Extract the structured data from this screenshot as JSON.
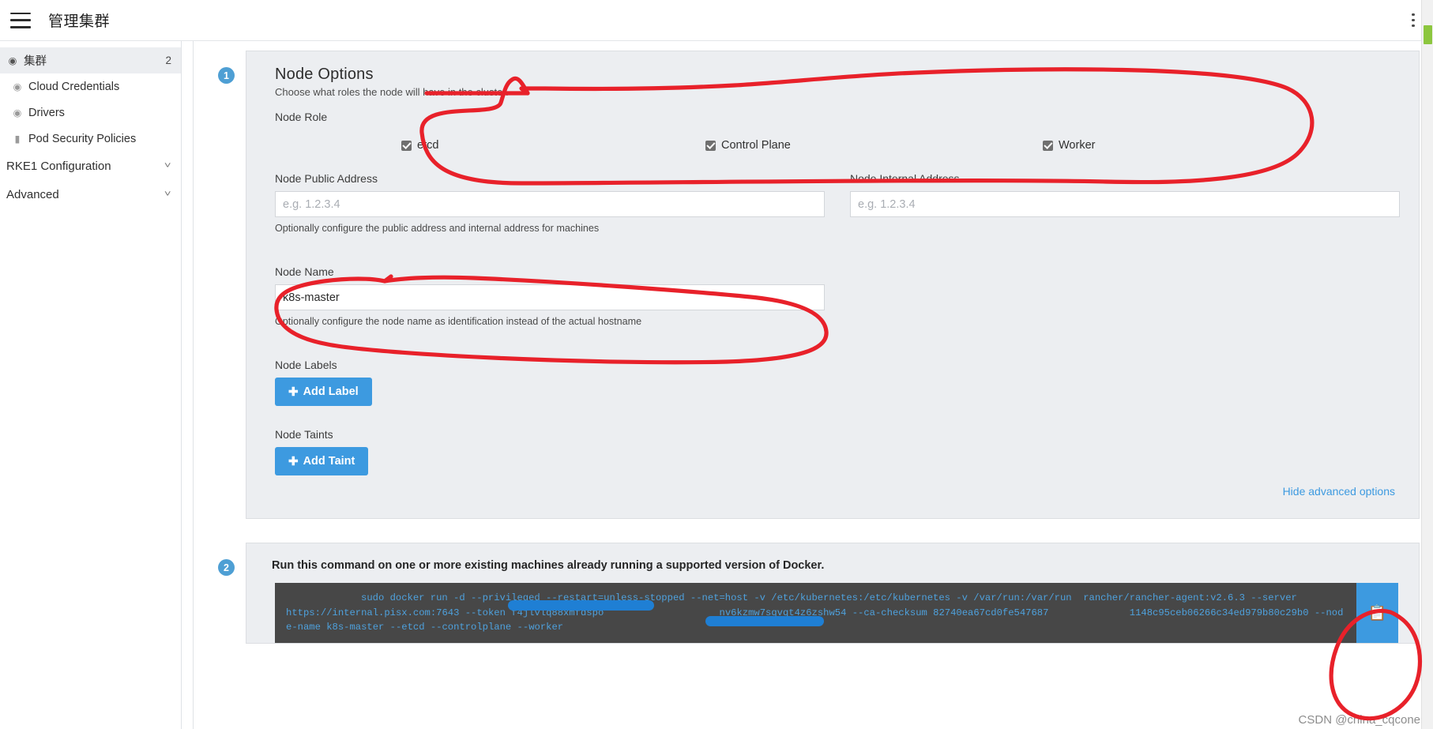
{
  "header": {
    "title": "管理集群",
    "menu_icon": "hamburger-icon",
    "overflow_icon": "kebab-menu-icon"
  },
  "sidebar": {
    "items": [
      {
        "label": "集群",
        "icon": "globe-icon",
        "badge": "2",
        "active": true
      },
      {
        "label": "Cloud Credentials",
        "icon": "globe-icon",
        "badge": "",
        "active": false
      },
      {
        "label": "Drivers",
        "icon": "globe-icon",
        "badge": "",
        "active": false
      },
      {
        "label": "Pod Security Policies",
        "icon": "folder-icon",
        "badge": "",
        "active": false
      }
    ],
    "sections": [
      {
        "label": "RKE1 Configuration",
        "chevron": "chevron-down-icon"
      },
      {
        "label": "Advanced",
        "chevron": "chevron-down-icon"
      }
    ]
  },
  "step1": {
    "number": "1",
    "title": "Node Options",
    "subtitle": "Choose what roles the node will have in the cluster.",
    "node_role_label": "Node Role",
    "roles": [
      {
        "label": "etcd",
        "checked": true
      },
      {
        "label": "Control Plane",
        "checked": true
      },
      {
        "label": "Worker",
        "checked": true
      }
    ],
    "public_address": {
      "label": "Node Public Address",
      "placeholder": "e.g. 1.2.3.4",
      "value": ""
    },
    "internal_address": {
      "label": "Node Internal Address",
      "placeholder": "e.g. 1.2.3.4",
      "value": ""
    },
    "address_help": "Optionally configure the public address and internal address for machines",
    "node_name": {
      "label": "Node Name",
      "placeholder": "",
      "value": "k8s-master"
    },
    "node_name_help": "Optionally configure the node name as identification instead of the actual hostname",
    "node_labels_label": "Node Labels",
    "add_label_button": "Add Label",
    "node_taints_label": "Node Taints",
    "add_taint_button": "Add Taint",
    "hide_advanced_link": "Hide advanced options",
    "plus_glyph": "✚"
  },
  "step2": {
    "number": "2",
    "instruction": "Run this command on one or more existing machines already running a supported version of Docker.",
    "command_line1": "sudo docker run -d --privileged --restart=unless-stopped --net=host -v /etc/kubernetes:/etc/kubernetes -v /var/run:/var/run  rancher/rancher-agent:v2.6.3 --server",
    "command_line2": "https://internal.pisx.com:7643 --token f4jlvlq88xmfdspo                    nv6kzmw7sqvqt4z6zshw54 --ca-checksum 82740ea67cd0fe547687              1148c95ceb06266c34ed979b80c29b0 --node-",
    "command_line3": "name k8s-master --etcd --controlplane --worker",
    "copy_icon": "clipboard-copy-icon"
  },
  "watermark": "CSDN @china_cqcone",
  "colors": {
    "accent": "#3d9ae0",
    "panel_bg": "#eceef1",
    "code_bg": "#474747",
    "code_fg": "#4ea1dd",
    "annotation": "#e8212a",
    "redaction": "#1f7fd4"
  }
}
